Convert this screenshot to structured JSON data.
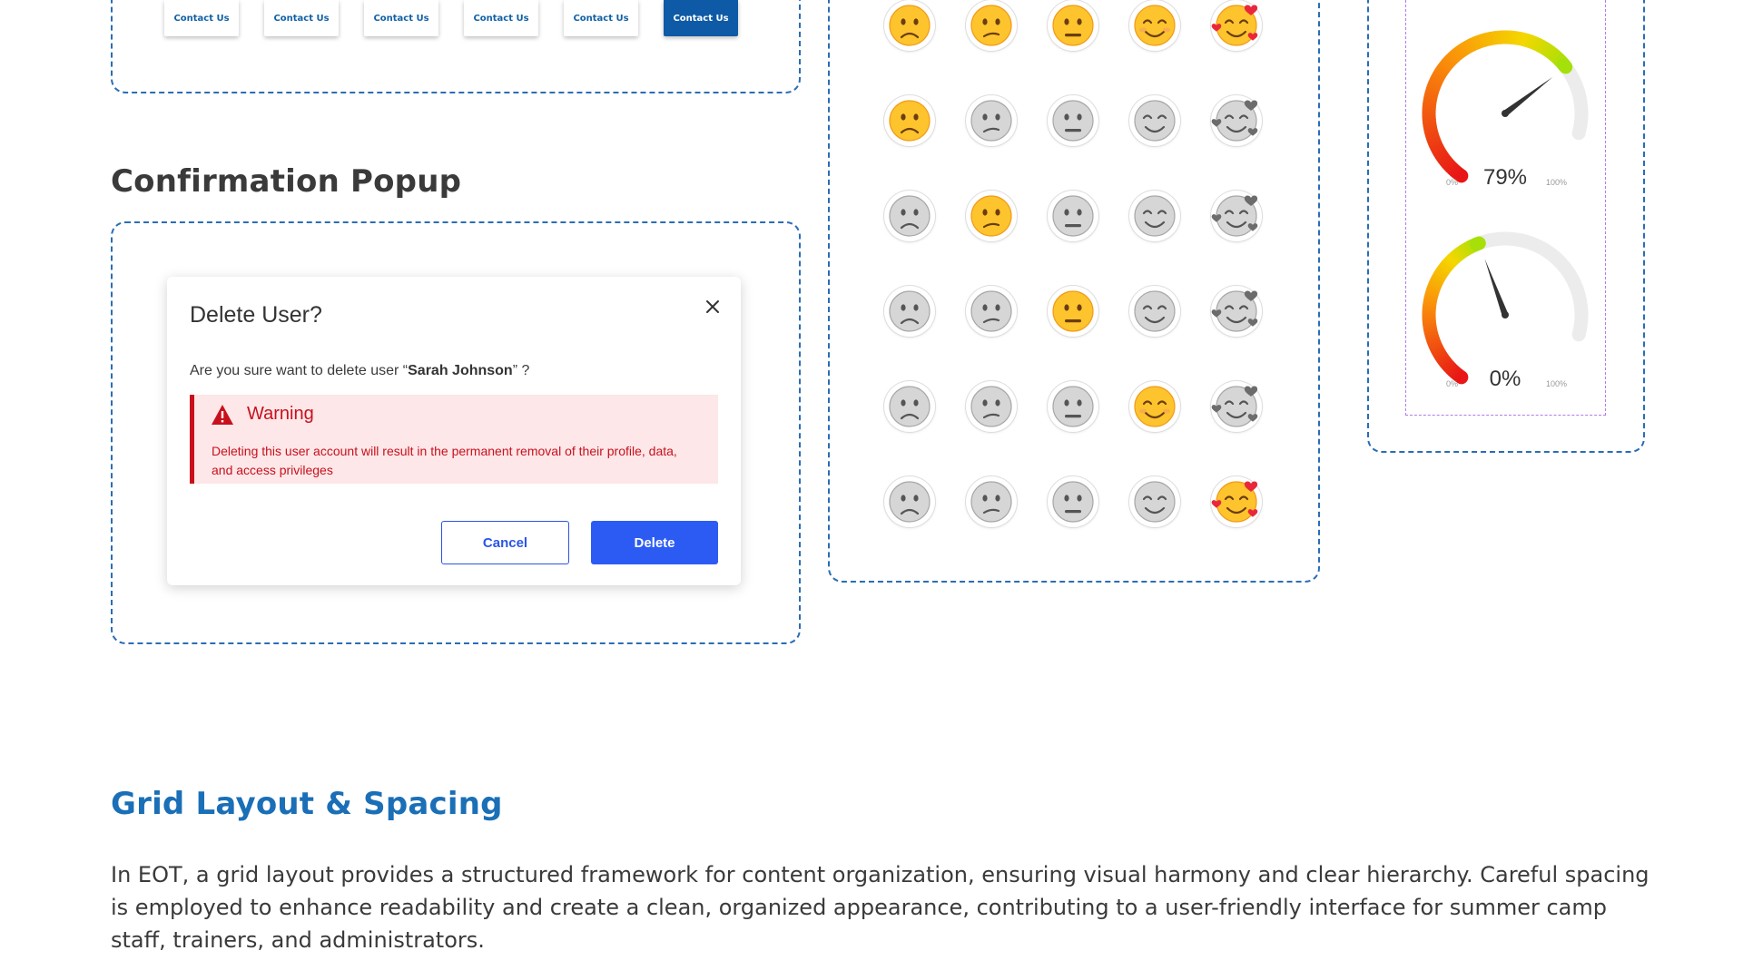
{
  "contact_buttons": [
    {
      "label": "Contact Us",
      "state": "default"
    },
    {
      "label": "Contact Us",
      "state": "default"
    },
    {
      "label": "Contact Us",
      "state": "default"
    },
    {
      "label": "Contact Us",
      "state": "default"
    },
    {
      "label": "Contact Us",
      "state": "default"
    },
    {
      "label": "Contact Us",
      "state": "active"
    }
  ],
  "confirmation_section": {
    "title": "Confirmation Popup"
  },
  "dialog": {
    "title": "Delete User?",
    "question_prefix": "Are you sure want to delete user “",
    "user_name": "Sarah Johnson",
    "question_suffix": "” ?",
    "warning_title": "Warning",
    "warning_body": "Deleting this user account will result in the permanent removal of their profile, data, and access privileges",
    "cancel_label": "Cancel",
    "delete_label": "Delete"
  },
  "emoji_grid": {
    "columns": [
      "frowning-face",
      "confused-face",
      "neutral-face",
      "smiling-face",
      "smiling-face-with-hearts"
    ],
    "rows": [
      [
        true,
        true,
        true,
        true,
        true
      ],
      [
        true,
        false,
        false,
        false,
        false
      ],
      [
        false,
        true,
        false,
        false,
        false
      ],
      [
        false,
        false,
        true,
        false,
        false
      ],
      [
        false,
        false,
        false,
        true,
        false
      ],
      [
        false,
        false,
        false,
        false,
        true
      ]
    ]
  },
  "gauges": [
    {
      "value_label": "79%",
      "min_label": "0%",
      "max_label": "100%",
      "value": 0.79
    },
    {
      "value_label": "0%",
      "min_label": "0%",
      "max_label": "100%",
      "value": 0.5
    }
  ],
  "grid_section": {
    "title": "Grid Layout & Spacing",
    "body": "In EOT, a grid layout provides a structured framework for content organization, ensuring visual harmony and clear hierarchy. Careful spacing is employed to enhance readability and create a clean, organized appearance, contributing to a user-friendly interface for summer camp staff, trainers, and administrators."
  },
  "colors": {
    "accent_blue": "#0f5aa6",
    "dash_blue": "#2a6db5",
    "heading_blue": "#1a6fb7",
    "danger_red": "#c8101d",
    "primary_button": "#2c5bf4",
    "gauge_inner_border": "#b37ce8"
  }
}
